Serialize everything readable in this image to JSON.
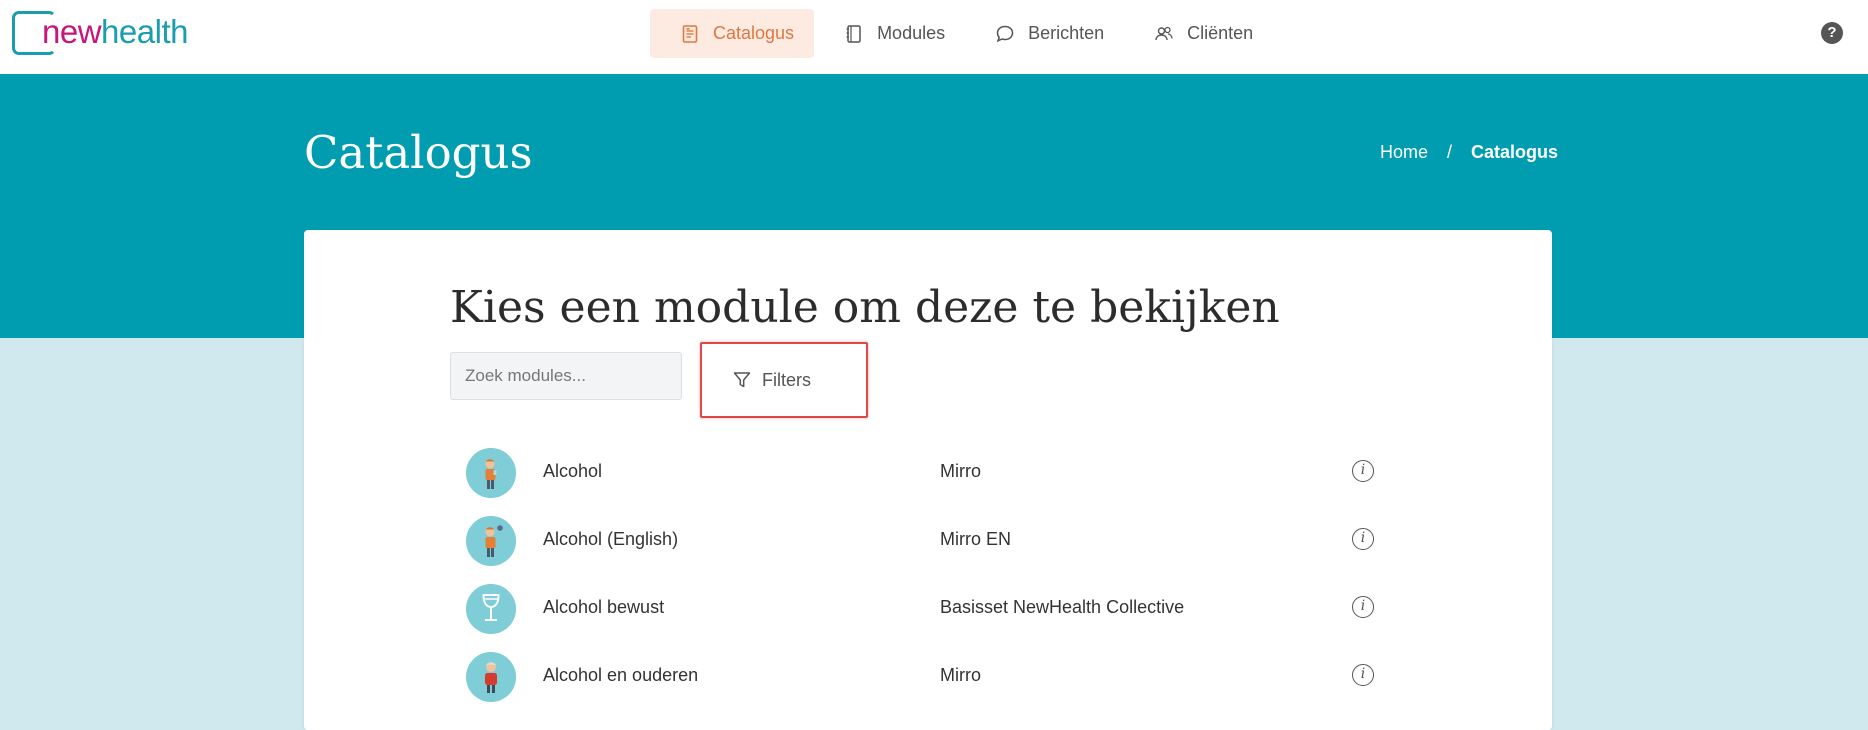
{
  "logo": {
    "part1": "new",
    "part2": "health"
  },
  "nav": {
    "items": [
      {
        "label": "Catalogus",
        "icon": "document-icon",
        "active": true
      },
      {
        "label": "Modules",
        "icon": "notebook-icon",
        "active": false
      },
      {
        "label": "Berichten",
        "icon": "chat-bubble-icon",
        "active": false
      },
      {
        "label": "Cliënten",
        "icon": "users-icon",
        "active": false
      }
    ],
    "help_label": "?"
  },
  "hero": {
    "title": "Catalogus",
    "breadcrumb": {
      "home": "Home",
      "separator": "/",
      "current": "Catalogus"
    }
  },
  "main": {
    "heading": "Kies een module om deze te bekijken",
    "search_placeholder": "Zoek modules...",
    "filters_label": "Filters",
    "modules": [
      {
        "name": "Alcohol",
        "owner": "Mirro",
        "icon": "person-drinking-icon"
      },
      {
        "name": "Alcohol (English)",
        "owner": "Mirro EN",
        "icon": "person-drinking-icon"
      },
      {
        "name": "Alcohol bewust",
        "owner": "Basisset NewHealth Collective",
        "icon": "wine-glass-icon"
      },
      {
        "name": "Alcohol en ouderen",
        "owner": "Mirro",
        "icon": "elderly-person-icon"
      }
    ],
    "info_glyph": "i"
  },
  "colors": {
    "brand_teal": "#009cb0",
    "brand_magenta": "#c8157b",
    "active_nav_bg": "#fdebe2",
    "active_nav_text": "#e0773e",
    "highlight_border": "#e04848"
  }
}
